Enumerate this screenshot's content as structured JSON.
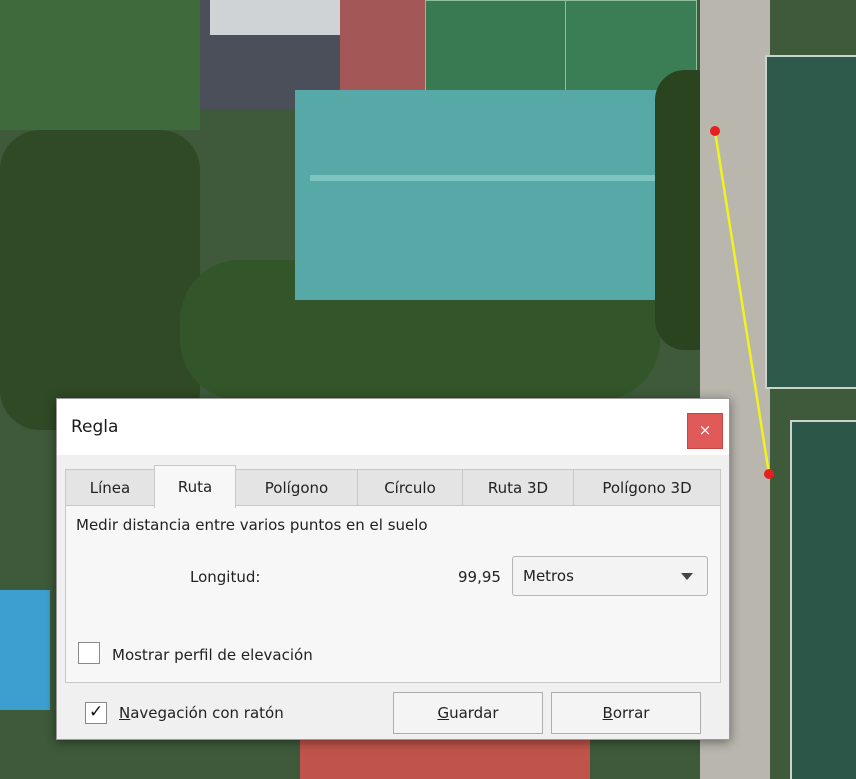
{
  "dialog": {
    "title": "Regla",
    "close_glyph": "×",
    "tabs": [
      {
        "label": "Línea",
        "active": false
      },
      {
        "label": "Ruta",
        "active": true
      },
      {
        "label": "Polígono",
        "active": false
      },
      {
        "label": "Círculo",
        "active": false
      },
      {
        "label": "Ruta 3D",
        "active": false
      },
      {
        "label": "Polígono 3D",
        "active": false
      }
    ],
    "description": "Medir distancia entre varios puntos en el suelo",
    "length_label": "Longitud:",
    "length_value": "99,95",
    "unit_select": {
      "selected": "Metros"
    },
    "elevation_checkbox": {
      "label": "Mostrar perfil de elevación",
      "checked": false
    },
    "navigation_checkbox": {
      "label_underlined": "N",
      "label_rest": "avegación con ratón",
      "checked": true,
      "check_glyph": "✓"
    },
    "save_button": {
      "underlined": "G",
      "rest": "uardar"
    },
    "clear_button": {
      "underlined": "B",
      "rest": "orrar"
    }
  },
  "map": {
    "path_color": "#f2f21e",
    "point_color": "#e81f1f"
  }
}
